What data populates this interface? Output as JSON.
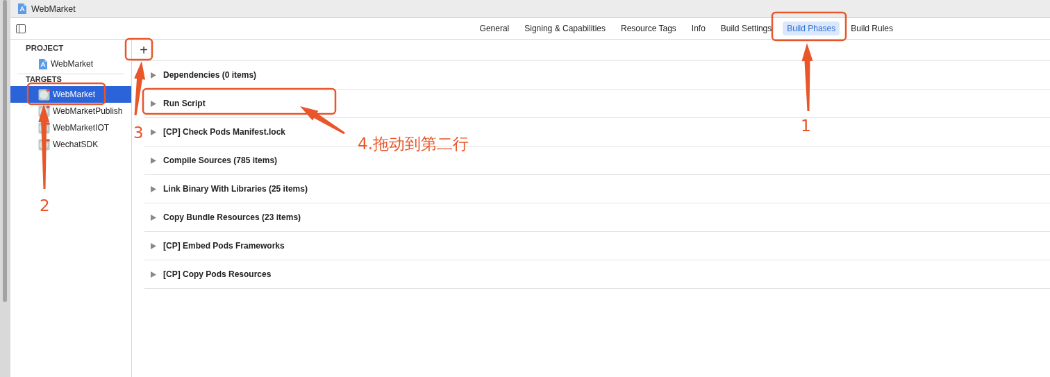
{
  "window": {
    "title": "WebMarket"
  },
  "tabs": [
    {
      "label": "General",
      "selected": false
    },
    {
      "label": "Signing & Capabilities",
      "selected": false
    },
    {
      "label": "Resource Tags",
      "selected": false
    },
    {
      "label": "Info",
      "selected": false
    },
    {
      "label": "Build Settings",
      "selected": false
    },
    {
      "label": "Build Phases",
      "selected": true
    },
    {
      "label": "Build Rules",
      "selected": false
    }
  ],
  "sidebar": {
    "sections": [
      {
        "title": "PROJECT",
        "items": [
          {
            "label": "WebMarket",
            "kind": "project",
            "selected": false
          }
        ]
      },
      {
        "title": "TARGETS",
        "items": [
          {
            "label": "WebMarket",
            "kind": "target",
            "selected": true
          },
          {
            "label": "WebMarketPublish",
            "kind": "target",
            "selected": false
          },
          {
            "label": "WebMarketIOT",
            "kind": "target",
            "selected": false
          },
          {
            "label": "WechatSDK",
            "kind": "target",
            "selected": false
          }
        ]
      }
    ]
  },
  "add_button": {
    "label": "+"
  },
  "phases": [
    {
      "label": "Dependencies (0 items)",
      "expanded": false
    },
    {
      "label": "Run Script",
      "expanded": false
    },
    {
      "label": "[CP] Check Pods Manifest.lock",
      "expanded": false
    },
    {
      "label": "Compile Sources (785 items)",
      "expanded": false
    },
    {
      "label": "Link Binary With Libraries (25 items)",
      "expanded": false
    },
    {
      "label": "Copy Bundle Resources (23 items)",
      "expanded": false
    },
    {
      "label": "[CP] Embed Pods Frameworks",
      "expanded": false
    },
    {
      "label": "[CP] Copy Pods Resources",
      "expanded": false
    }
  ],
  "annotations": [
    {
      "label": "1"
    },
    {
      "label": "2"
    },
    {
      "label": "3"
    },
    {
      "label": "4.拖动到第二行"
    }
  ]
}
